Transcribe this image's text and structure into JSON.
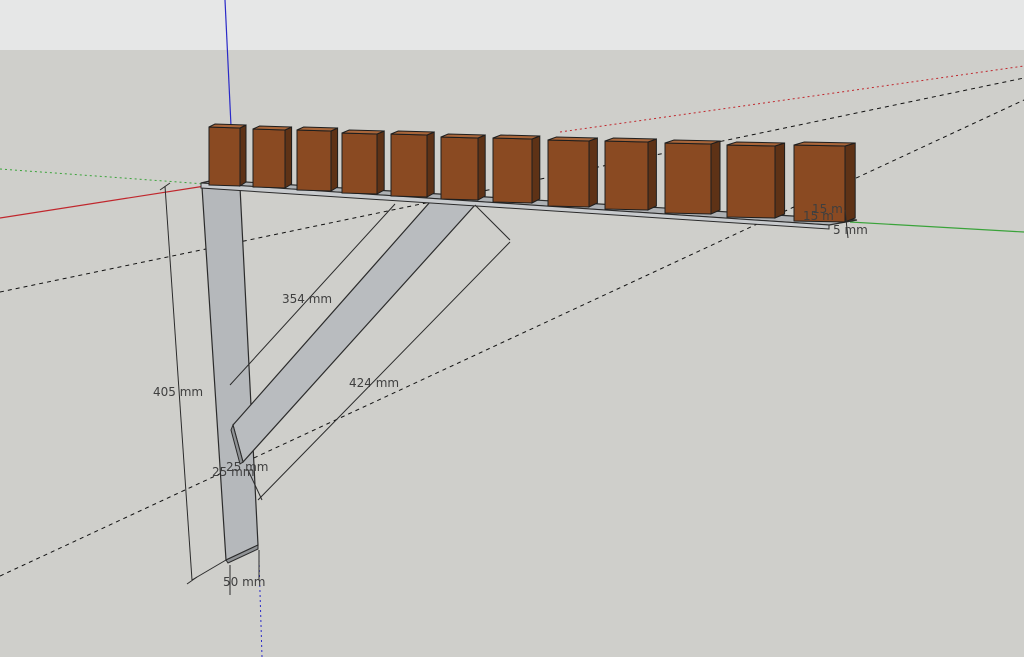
{
  "colors": {
    "sky": "#e6e7e7",
    "ground": "#cfcfcb",
    "metal": "#b5b8bb",
    "metal_dark": "#8f9295",
    "wood": "#8a4a22",
    "wood_dark": "#5e3216",
    "wood_top": "#a9663a",
    "axis_red": "#c0272d",
    "axis_green": "#3aa33a",
    "axis_blue": "#2a2ac8",
    "guide": "#111111"
  },
  "dimensions": {
    "vertical_length": "405 mm",
    "strut_length": "354 mm",
    "diagonal_length": "424 mm",
    "base_width": "50 mm",
    "small_a": "25 mm",
    "small_b": "25 mm",
    "top_height": "15 m",
    "top_depth": "15 m",
    "shelf_thickness": "5 mm"
  },
  "blocks_count_label": "",
  "scene": {
    "blocks": 12
  }
}
